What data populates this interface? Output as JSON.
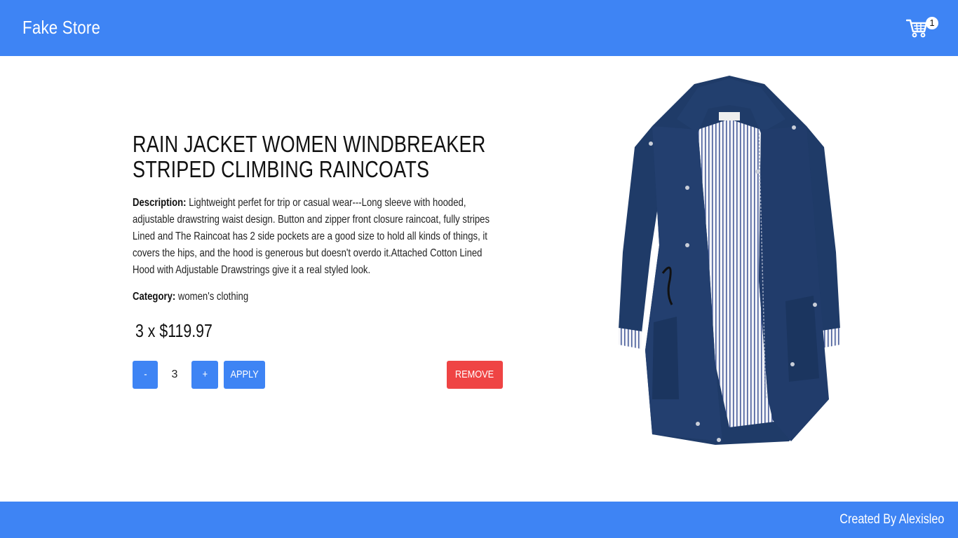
{
  "header": {
    "brand": "Fake Store",
    "cart_count": "1",
    "cart_icon": "cart-icon"
  },
  "product": {
    "title": "RAIN JACKET WOMEN WINDBREAKER STRIPED CLIMBING RAINCOATS",
    "description_label": "Description:",
    "description": "Lightweight perfet for trip or casual wear---Long sleeve with hooded, adjustable drawstring waist design. Button and zipper front closure raincoat, fully stripes Lined and The Raincoat has 2 side pockets are a good size to hold all kinds of things, it covers the hips, and the hood is generous but doesn't overdo it.Attached Cotton Lined Hood with Adjustable Drawstrings give it a real styled look.",
    "category_label": "Category:",
    "category": "women's clothing",
    "price_line": "3 x $119.97"
  },
  "controls": {
    "decrement": "-",
    "quantity": "3",
    "increment": "+",
    "apply": "APPLY",
    "remove": "REMOVE"
  },
  "footer": {
    "credit": "Created By Alexisleo"
  },
  "colors": {
    "primary": "#3e84f4",
    "danger": "#ef4444",
    "jacket": "#1e3a66"
  }
}
